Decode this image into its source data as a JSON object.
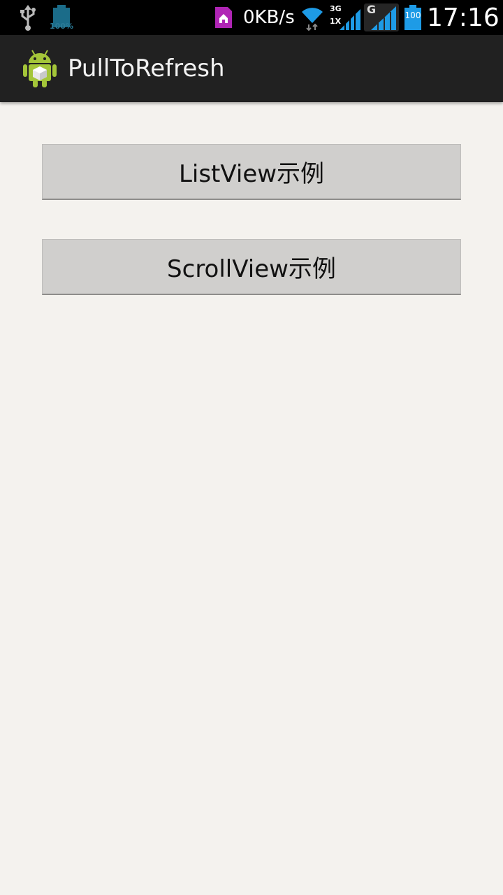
{
  "status_bar": {
    "usb_icon": "usb-icon",
    "battery_left_label": "100%",
    "net_speed": "0KB/s",
    "sim1_label_top": "3G",
    "sim1_label_bottom": "1X",
    "sim2_label": "G",
    "battery_level_label": "100",
    "time": "17:16",
    "colors": {
      "background": "#000000",
      "accent": "#1e9be6",
      "sim_icon": "#b025b5"
    }
  },
  "action_bar": {
    "app_icon": "android-icon",
    "title": "PullToRefresh",
    "colors": {
      "background": "#212121",
      "title": "#f2f2f2"
    }
  },
  "main": {
    "buttons": [
      {
        "label": "ListView示例"
      },
      {
        "label": "ScrollView示例"
      }
    ],
    "colors": {
      "background": "#f4f2ee",
      "button": "#d0cfcd"
    }
  }
}
